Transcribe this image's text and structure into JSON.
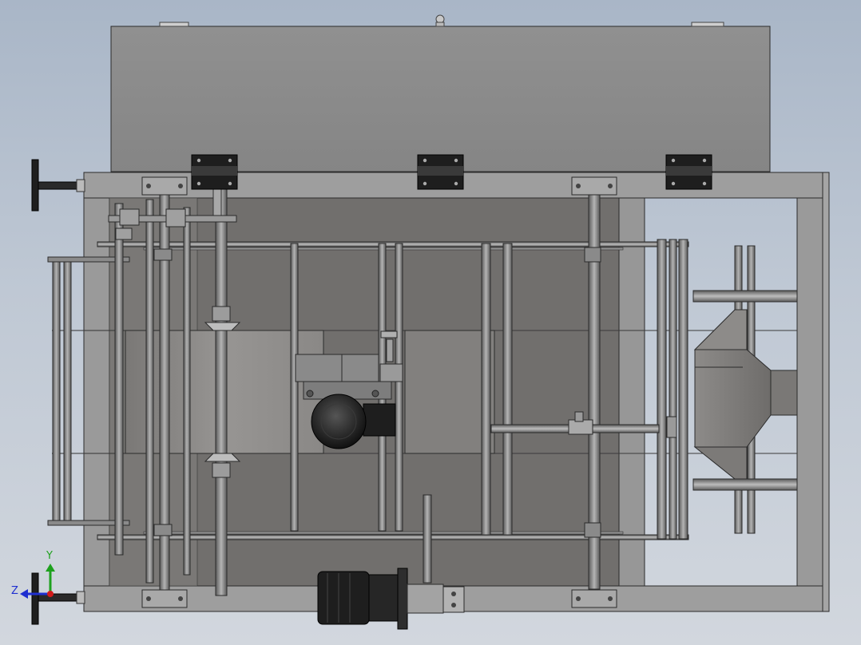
{
  "axis_triad": {
    "y_label": "Y",
    "z_label": "Z",
    "y_color": "#1ea11e",
    "z_color": "#1f2fd0",
    "x_color": "#d01a1a"
  },
  "colors": {
    "background_top": "#a9b6c7",
    "background_bottom": "#d2d7de",
    "cover": "#8c8c8c",
    "frame": "#9a9a9a",
    "bed": "#6f6d6b",
    "belt": "#8e8c8a",
    "motor": "#1e1e1e",
    "edge": "#2b2b2b"
  },
  "components": [
    "hinged-cover",
    "machine-frame",
    "conveyor-bed",
    "conveyor-belt",
    "gear-motor-center",
    "drive-motor-bottom",
    "discharge-hopper",
    "handwheel-top",
    "handwheel-bottom"
  ]
}
